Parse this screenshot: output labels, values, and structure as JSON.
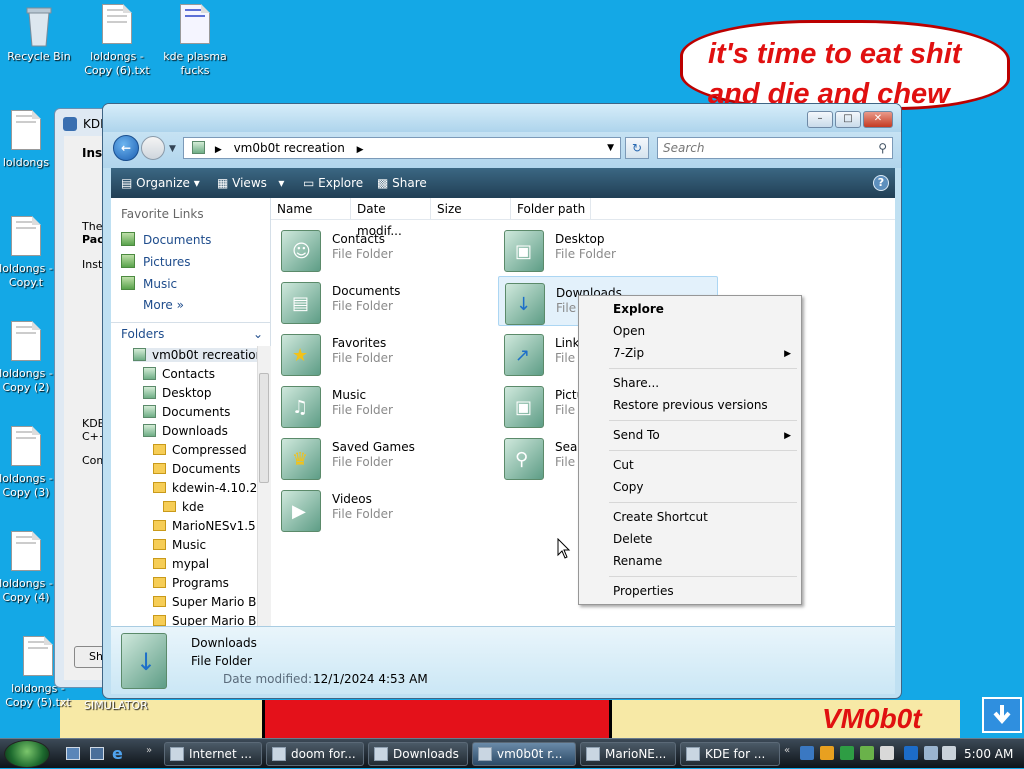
{
  "desktop": {
    "icons": [
      {
        "label": "Recycle Bin"
      },
      {
        "label": "loldongs - Copy (6).txt"
      },
      {
        "label": "kde plasma fucks"
      },
      {
        "label": "loldongs"
      },
      {
        "label": "loldongs - Copy.t"
      },
      {
        "label": "loldongs - Copy (2)"
      },
      {
        "label": "loldongs - Copy (3)"
      },
      {
        "label": "loldongs - Copy (4)"
      },
      {
        "label": "loldongs - Copy (5).txt"
      }
    ],
    "speech_bubble": "it's time to eat shit and die and chew",
    "logo_text": "VM0b0t",
    "partial_label": "SIMULATOR"
  },
  "kde_window": {
    "title": "KDE",
    "lines": [
      "Ins",
      "The",
      "Pac",
      "Inst",
      "KDE",
      "C++",
      "Com",
      "Sh"
    ]
  },
  "explorer": {
    "address": "vm0b0t recreation",
    "search_placeholder": "Search",
    "toolbar": {
      "organize": "Organize",
      "views": "Views",
      "explore": "Explore",
      "share": "Share",
      "help": "?"
    },
    "favorite_links_header": "Favorite Links",
    "favorite_links": [
      "Documents",
      "Pictures",
      "Music"
    ],
    "more": "More",
    "folders_header": "Folders",
    "tree": [
      "vm0b0t recreation",
      "Contacts",
      "Desktop",
      "Documents",
      "Downloads",
      "Compressed",
      "Documents",
      "kdewin-4.10.2",
      "kde",
      "MarioNESv1.5",
      "Music",
      "mypal",
      "Programs",
      "Super Mario Br",
      "Super Mario Br"
    ],
    "columns": [
      "Name",
      "Date modif...",
      "Size",
      "Folder path"
    ],
    "items": [
      {
        "name": "Contacts",
        "type": "File Folder"
      },
      {
        "name": "Desktop",
        "type": "File Folder"
      },
      {
        "name": "Documents",
        "type": "File Folder"
      },
      {
        "name": "Downloads",
        "type": "File Fo"
      },
      {
        "name": "Favorites",
        "type": "File Folder"
      },
      {
        "name": "Links",
        "type": "File F"
      },
      {
        "name": "Music",
        "type": "File Folder"
      },
      {
        "name": "Pictu",
        "type": "File F"
      },
      {
        "name": "Saved Games",
        "type": "File Folder"
      },
      {
        "name": "Searc",
        "type": "File F"
      },
      {
        "name": "Videos",
        "type": "File Folder"
      }
    ],
    "details": {
      "name": "Downloads",
      "type": "File Folder",
      "date_label": "Date modified:",
      "date": "12/1/2024 4:53 AM"
    }
  },
  "context_menu": {
    "items": [
      "Explore",
      "Open",
      "7-Zip",
      "Share...",
      "Restore previous versions",
      "Send To",
      "Cut",
      "Copy",
      "Create Shortcut",
      "Delete",
      "Rename",
      "Properties"
    ]
  },
  "taskbar": {
    "buttons": [
      "Internet ...",
      "doom for...",
      "Downloads",
      "vm0b0t r...",
      "MarioNE...",
      "KDE for ..."
    ],
    "clock": "5:00 AM"
  }
}
